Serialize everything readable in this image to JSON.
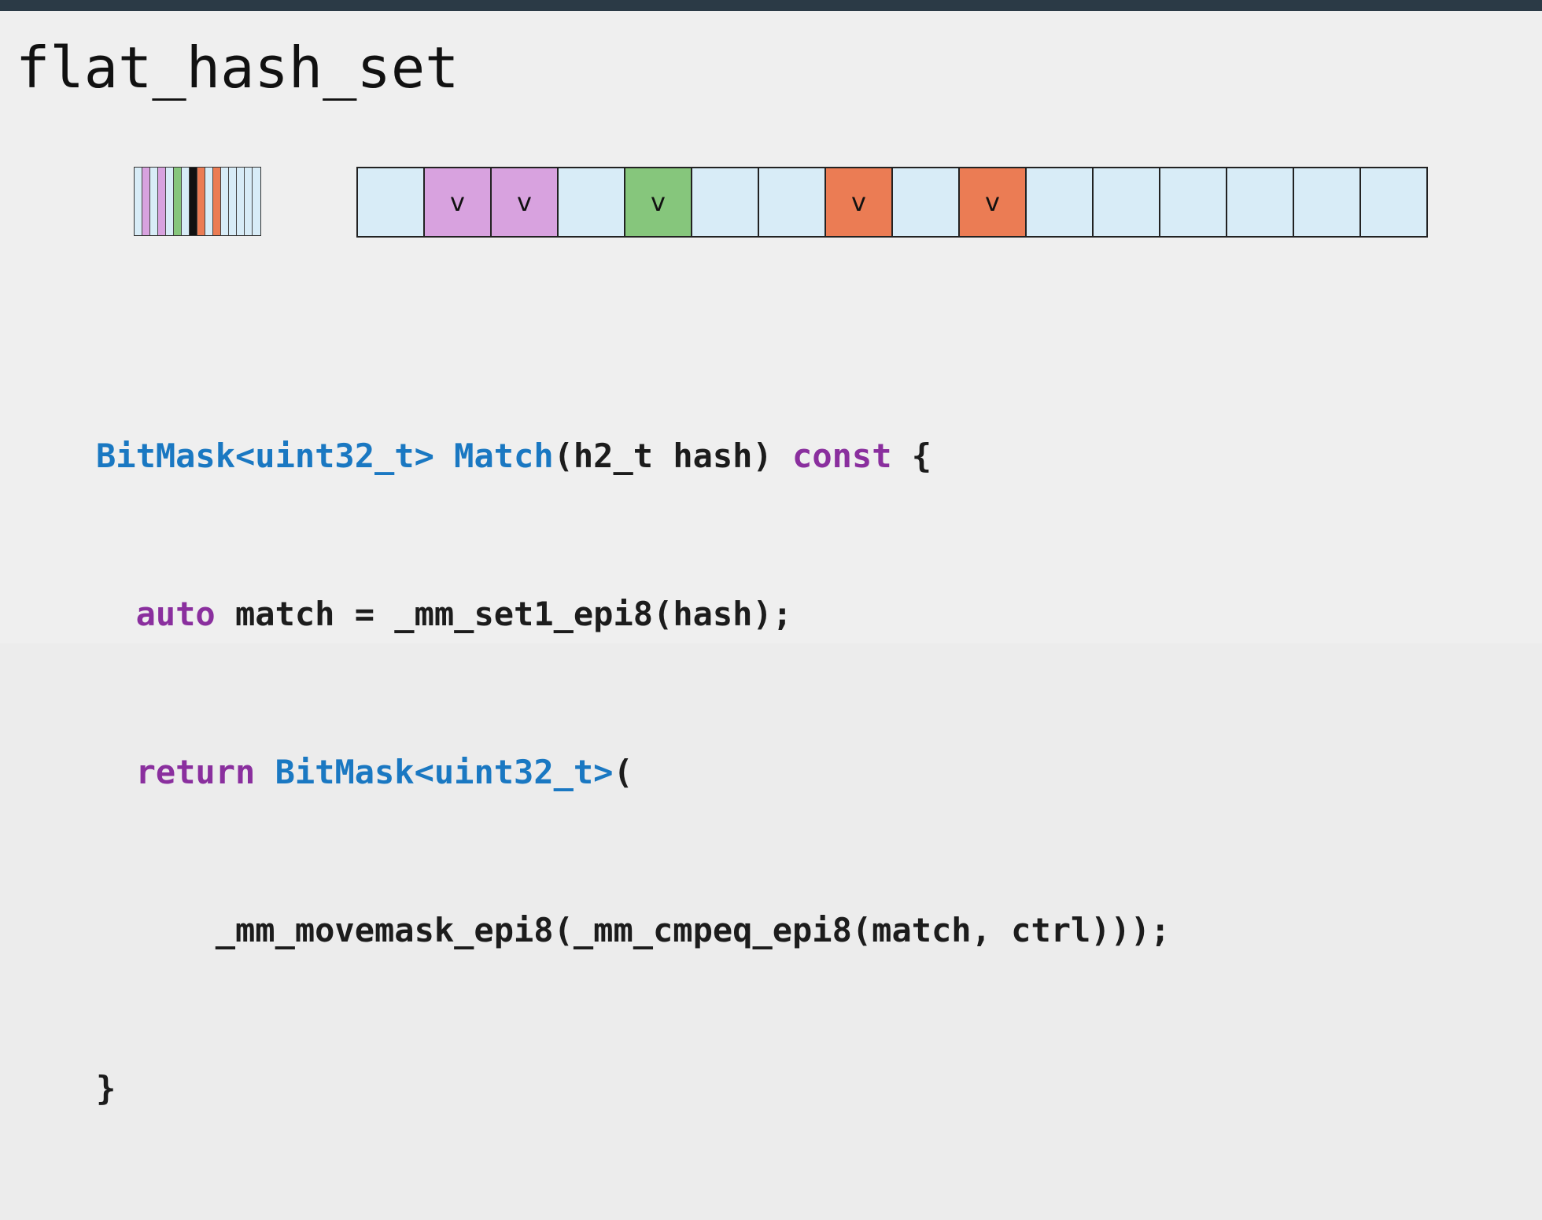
{
  "title": "flat_hash_set",
  "colors": {
    "empty": "#d8ecf7",
    "purple": "#d8a2df",
    "green": "#86c67c",
    "orange": "#eb7c54",
    "black": "#111111"
  },
  "ctrl_bytes": [
    "empty",
    "purple",
    "empty",
    "purple",
    "empty",
    "green",
    "empty",
    "black",
    "orange",
    "empty",
    "orange",
    "empty",
    "empty",
    "empty",
    "empty",
    "empty"
  ],
  "slots": [
    {
      "color": "empty",
      "label": ""
    },
    {
      "color": "purple",
      "label": "v"
    },
    {
      "color": "purple",
      "label": "v"
    },
    {
      "color": "empty",
      "label": ""
    },
    {
      "color": "green",
      "label": "v"
    },
    {
      "color": "empty",
      "label": ""
    },
    {
      "color": "empty",
      "label": ""
    },
    {
      "color": "orange",
      "label": "v"
    },
    {
      "color": "empty",
      "label": ""
    },
    {
      "color": "orange",
      "label": "v"
    },
    {
      "color": "empty",
      "label": ""
    },
    {
      "color": "empty",
      "label": ""
    },
    {
      "color": "empty",
      "label": ""
    },
    {
      "color": "empty",
      "label": ""
    },
    {
      "color": "empty",
      "label": ""
    },
    {
      "color": "empty",
      "label": ""
    }
  ],
  "code": {
    "line1": {
      "ret_type": "BitMask<uint32_t>",
      "fn_name": "Match",
      "params_open": "(h2_t hash) ",
      "qualifier": "const",
      "brace": " {"
    },
    "line2": {
      "indent": "  ",
      "keyword": "auto",
      "rest": " match = _mm_set1_epi8(hash);"
    },
    "line3": {
      "indent": "  ",
      "keyword": "return",
      "space": " ",
      "type": "BitMask<uint32_t>",
      "paren": "("
    },
    "line4": "      _mm_movemask_epi8(_mm_cmpeq_epi8(match, ctrl)));",
    "line5": "}"
  }
}
